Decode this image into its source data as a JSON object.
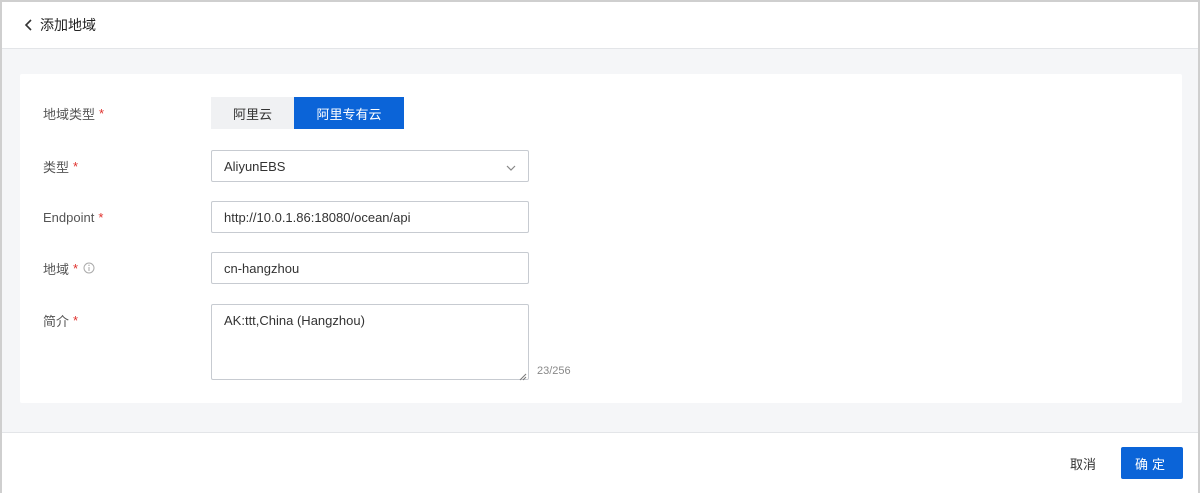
{
  "header": {
    "title": "添加地域",
    "back_icon": "chevron-left-icon"
  },
  "form": {
    "region_type": {
      "label": "地域类型",
      "required_mark": "*",
      "options": [
        "阿里云",
        "阿里专有云"
      ],
      "selected": "阿里专有云"
    },
    "type": {
      "label": "类型",
      "required_mark": "*",
      "value": "AliyunEBS"
    },
    "endpoint": {
      "label": "Endpoint",
      "required_mark": "*",
      "value": "http://10.0.1.86:18080/ocean/api"
    },
    "region": {
      "label": "地域",
      "required_mark": "*",
      "value": "cn-hangzhou"
    },
    "description": {
      "label": "简介",
      "required_mark": "*",
      "value": "AK:ttt,China (Hangzhou)",
      "counter": "23/256"
    }
  },
  "footer": {
    "cancel_label": "取消",
    "ok_label": "确定"
  },
  "colors": {
    "primary": "#0b64d8",
    "required": "#e0302c",
    "page_bg": "#f5f6f8"
  }
}
